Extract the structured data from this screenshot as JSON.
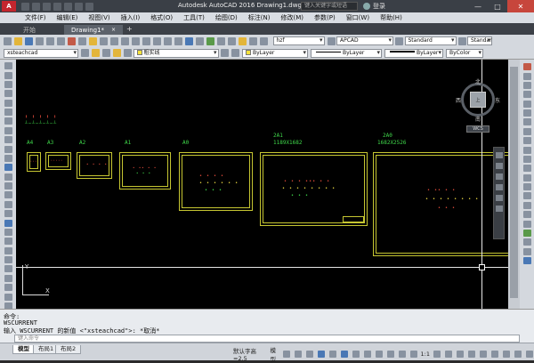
{
  "window": {
    "title": "Autodesk AutoCAD 2016    Drawing1.dwg",
    "search_placeholder": "键入关键字或短语",
    "login_label": "登录",
    "controls": {
      "minimize": "—",
      "maximize": "□",
      "close": "✕"
    }
  },
  "menubar": {
    "items": [
      "文件(F)",
      "编辑(E)",
      "视图(V)",
      "插入(I)",
      "格式(O)",
      "工具(T)",
      "绘图(D)",
      "标注(N)",
      "修改(M)",
      "参数(P)",
      "窗口(W)",
      "帮助(H)"
    ]
  },
  "tabs": {
    "start": "开始",
    "drawing": "Drawing1*",
    "close_glyph": "×",
    "add_glyph": "+"
  },
  "toolbar1": {
    "layer_combo": "hzf",
    "style_combo": "APCAD",
    "dim_style": "Standard",
    "text_style": "Standar"
  },
  "toolbar2": {
    "workspace": "xsteachcad",
    "layer_name": "粗实线",
    "color": "ByLayer",
    "linetype": "ByLayer",
    "lineweight": "ByLayer",
    "plotstyle": "ByColor"
  },
  "drawing": {
    "sheet_labels": [
      "A4",
      "A3",
      "A2",
      "A1",
      "A0",
      "2A1",
      "1189X1682",
      "2A0",
      "1682X2526"
    ],
    "ucs_y": "Y",
    "ucs_x": "X"
  },
  "viewcube": {
    "north": "北",
    "south": "南",
    "west": "西",
    "east": "东",
    "face": "上",
    "wcs": "WCS"
  },
  "command": {
    "history": [
      "命令:",
      "WSCURRENT",
      "输入 WSCURRENT 的新值 <\"xsteachcad\">: *取消*"
    ],
    "placeholder": "键入命令"
  },
  "statusbar": {
    "layout_tabs": [
      "模型",
      "布局1",
      "布局2"
    ],
    "annot_scale": "默认字高=2.5",
    "model_label": "模型",
    "scale": "1:1"
  },
  "colors": {
    "canvas": "#000000",
    "sheet_border": "#c6c632",
    "label_green": "#3fd84a"
  }
}
